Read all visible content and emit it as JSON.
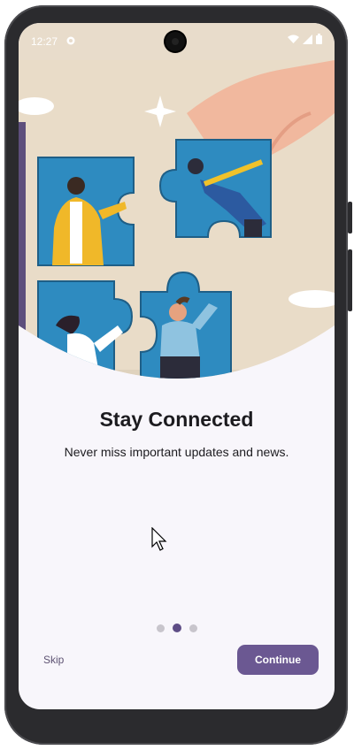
{
  "status_bar": {
    "time": "12:27",
    "icons": [
      "app-notification-icon",
      "wifi-icon",
      "signal-icon",
      "battery-icon"
    ]
  },
  "onboarding": {
    "illustration": "puzzle-team-illustration",
    "title": "Stay Connected",
    "subtitle": "Never miss important updates and news.",
    "page_indicator": {
      "total": 3,
      "active_index": 1
    }
  },
  "actions": {
    "skip_label": "Skip",
    "continue_label": "Continue"
  },
  "colors": {
    "accent": "#6b5892",
    "active_dot": "#5e4d86",
    "hero_bg": "#e8dccb",
    "puzzle_blue": "#2e8bc0"
  }
}
